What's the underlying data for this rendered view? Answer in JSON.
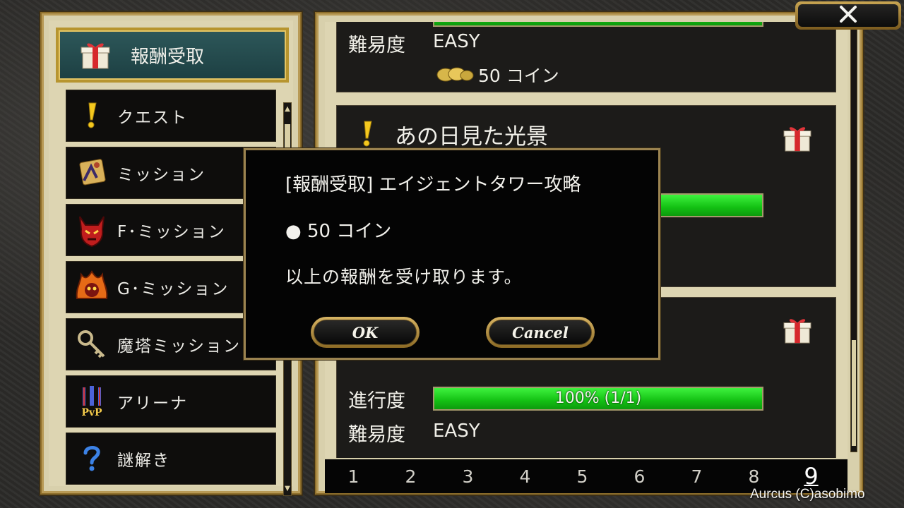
{
  "sidebar": {
    "reward_tab": {
      "label": "報酬受取",
      "icon": "gift-icon"
    },
    "items": [
      {
        "label": "クエスト",
        "icon": "exclamation-icon"
      },
      {
        "label": "ミッション",
        "icon": "scroll-icon"
      },
      {
        "label": "F･ミッション",
        "icon": "demon-icon"
      },
      {
        "label": "G･ミッション",
        "icon": "flame-beast-icon"
      },
      {
        "label": "魔塔ミッション",
        "icon": "key-icon"
      },
      {
        "label": "アリーナ",
        "icon": "pvp-icon"
      },
      {
        "label": "謎解き",
        "icon": "question-icon"
      }
    ]
  },
  "quest_list": {
    "card1": {
      "difficulty_label": "難易度",
      "difficulty": "EASY",
      "reward": "50 コイン"
    },
    "card2": {
      "title": "あの日見た光景"
    },
    "card3": {
      "progress_label": "進行度",
      "progress_text": "100% (1/1)",
      "progress": 1.0,
      "difficulty_label": "難易度",
      "difficulty": "EASY"
    }
  },
  "pagination": {
    "pages": [
      "1",
      "2",
      "3",
      "4",
      "5",
      "6",
      "7",
      "8",
      "9"
    ],
    "current": "9"
  },
  "dialog": {
    "title": "[報酬受取] エイジェントタワー攻略",
    "reward": "● 50 コイン",
    "message": "以上の報酬を受け取ります。",
    "ok_label": "OK",
    "cancel_label": "Cancel"
  },
  "copyright": "Aurcus (C)asobimo",
  "colors": {
    "accent_gold": "#b7952f",
    "progress_green": "#13c013",
    "tab_teal": "#2d5759"
  }
}
